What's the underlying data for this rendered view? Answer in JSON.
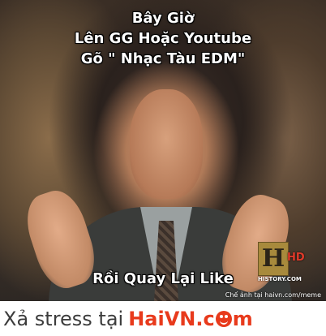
{
  "meme": {
    "top_lines": [
      "Bây Giờ",
      "Lên GG Hoặc Youtube",
      "Gõ \" Nhạc Tàu EDM\""
    ],
    "bottom_text": "Rồi Quay Lại Like",
    "credit": "Chế ảnh tại haivn.com/meme",
    "logo": {
      "letter": "H",
      "hd": "HD",
      "site": "HISTORY.COM"
    }
  },
  "footer": {
    "prefix": "Xả stress tại",
    "brand_part1": "HaiVN.c",
    "brand_part2": "m",
    "brand_icon": "smiley-icon"
  },
  "colors": {
    "brand": "#e83a1c",
    "caption": "#ffffff",
    "footer_text": "#3c3c3c"
  }
}
